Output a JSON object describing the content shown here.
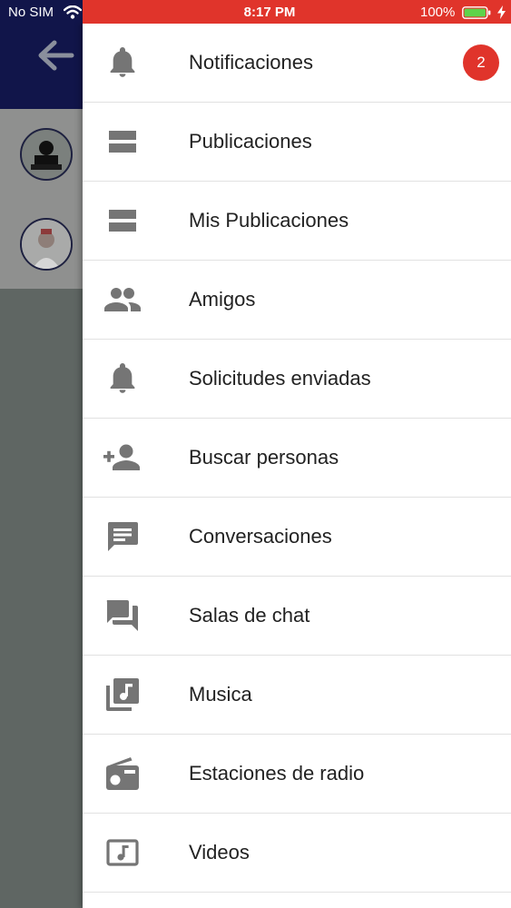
{
  "status_bar": {
    "carrier": "No SIM",
    "time": "8:17 PM",
    "battery": "100%"
  },
  "colors": {
    "accent": "#e0342b",
    "header": "#11154a",
    "icon": "#757575"
  },
  "background_app": {
    "header_icon": "arrow-left-icon",
    "contacts": [
      "avatar-1",
      "avatar-2"
    ]
  },
  "drawer": {
    "items": [
      {
        "label": "Notificaciones",
        "icon": "bell-icon",
        "badge": "2"
      },
      {
        "label": "Publicaciones",
        "icon": "view-stream-icon"
      },
      {
        "label": "Mis Publicaciones",
        "icon": "view-stream-icon"
      },
      {
        "label": "Amigos",
        "icon": "people-icon"
      },
      {
        "label": "Solicitudes enviadas",
        "icon": "bell-icon"
      },
      {
        "label": "Buscar personas",
        "icon": "person-add-icon"
      },
      {
        "label": "Conversaciones",
        "icon": "chat-icon"
      },
      {
        "label": "Salas de chat",
        "icon": "forum-icon"
      },
      {
        "label": "Musica",
        "icon": "library-music-icon"
      },
      {
        "label": "Estaciones de radio",
        "icon": "radio-icon"
      },
      {
        "label": "Videos",
        "icon": "music-video-icon"
      }
    ]
  }
}
